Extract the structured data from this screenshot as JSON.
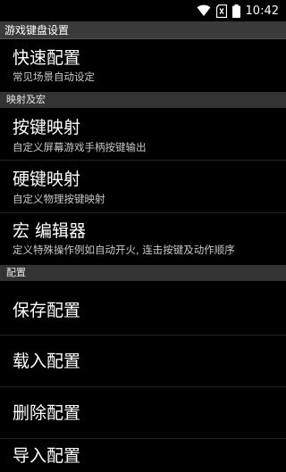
{
  "status_bar": {
    "time": "10:42",
    "icons": [
      "wifi-icon",
      "sim-no-signal-icon",
      "battery-icon"
    ]
  },
  "title_bar": {
    "title": "游戏键盘设置"
  },
  "sections": [
    {
      "header": "",
      "items": [
        {
          "title": "快速配置",
          "summary": "常见场景自动设定"
        }
      ]
    },
    {
      "header": "映射及宏",
      "items": [
        {
          "title": "按键映射",
          "summary": "自定义屏幕游戏手柄按键输出"
        },
        {
          "title": "硬键映射",
          "summary": "自定义物理按键映射"
        },
        {
          "title": "宏 编辑器",
          "summary": "定义特殊操作例如自动开火, 连击按键及动作顺序"
        }
      ]
    },
    {
      "header": "配置",
      "items": [
        {
          "title": "保存配置",
          "summary": ""
        },
        {
          "title": "载入配置",
          "summary": ""
        },
        {
          "title": "删除配置",
          "summary": ""
        },
        {
          "title": "导入配置",
          "summary": ""
        }
      ]
    }
  ]
}
